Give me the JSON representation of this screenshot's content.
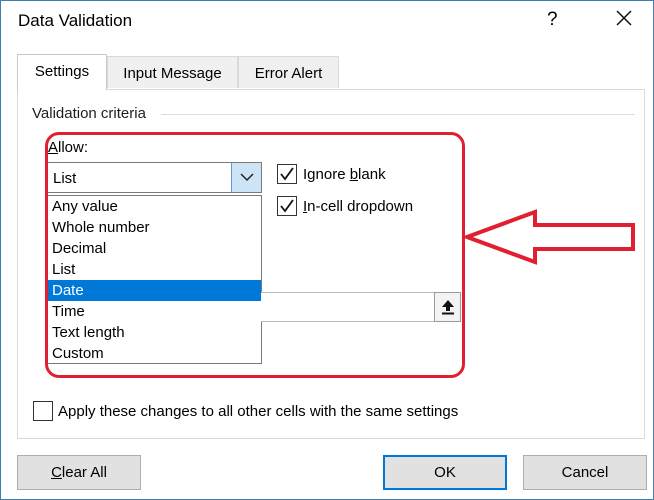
{
  "dialog": {
    "title": "Data Validation",
    "help_label": "?"
  },
  "tabs": [
    {
      "label": "Settings",
      "active": true
    },
    {
      "label": "Input Message",
      "active": false
    },
    {
      "label": "Error Alert",
      "active": false
    }
  ],
  "settings": {
    "section_label": "Validation criteria",
    "allow_label_accel": "A",
    "allow_label_rest": "llow:",
    "allow_value": "List",
    "allow_options": [
      "Any value",
      "Whole number",
      "Decimal",
      "List",
      "Date",
      "Time",
      "Text length",
      "Custom"
    ],
    "highlighted_option": "Date",
    "ignore_blank": {
      "label_pre": "Ignore ",
      "label_accel": "b",
      "label_post": "lank",
      "checked": true
    },
    "incell_dropdown": {
      "label_accel": "I",
      "label_post": "n-cell dropdown",
      "checked": true
    },
    "source_value": ""
  },
  "apply_all": {
    "label": "Apply these changes to all other cells with the same settings",
    "checked": false
  },
  "buttons": {
    "clear_all_accel": "C",
    "clear_all_rest": "lear All",
    "ok": "OK",
    "cancel": "Cancel"
  },
  "colors": {
    "annotation": "#e02030",
    "selection": "#0078d7",
    "default_button_border": "#0078d7"
  }
}
